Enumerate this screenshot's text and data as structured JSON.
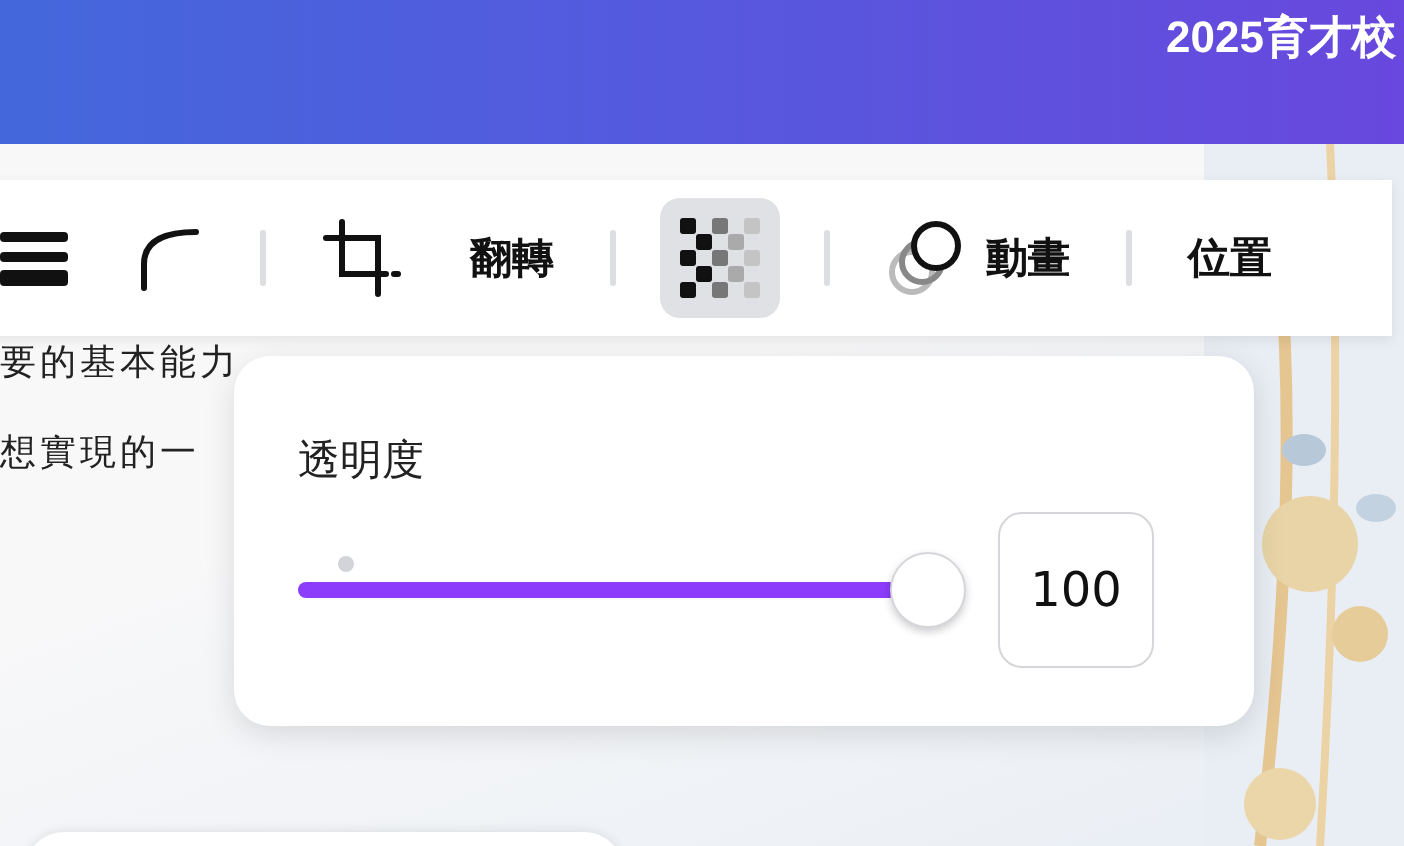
{
  "header": {
    "title": "2025育才校"
  },
  "document": {
    "lines": [
      "要的基本能力",
      "想實現的一"
    ]
  },
  "toolbar": {
    "items": [
      {
        "kind": "border",
        "selected": false
      },
      {
        "kind": "corner",
        "selected": false
      },
      {
        "kind": "separator"
      },
      {
        "kind": "crop",
        "selected": false
      },
      {
        "kind": "text",
        "label": "翻轉",
        "selected": false
      },
      {
        "kind": "separator"
      },
      {
        "kind": "transparency",
        "selected": true
      },
      {
        "kind": "separator"
      },
      {
        "kind": "animate",
        "label": "動畫",
        "selected": false
      },
      {
        "kind": "separator"
      },
      {
        "kind": "text",
        "label": "位置",
        "selected": false
      }
    ]
  },
  "opacity_popup": {
    "label": "透明度",
    "level": 1,
    "value": "100"
  }
}
